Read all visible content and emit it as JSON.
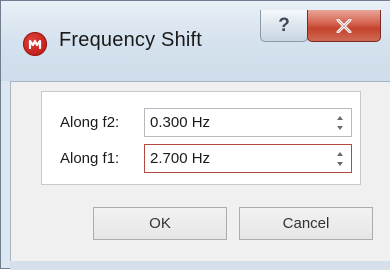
{
  "window": {
    "title": "Frequency Shift",
    "help_label": "?",
    "icon": "app-logo-icon",
    "close_icon": "close-icon"
  },
  "fields": [
    {
      "label": "Along f2:",
      "value": "0.300 Hz"
    },
    {
      "label": "Along f1:",
      "value": "2.700 Hz"
    }
  ],
  "buttons": {
    "ok_label": "OK",
    "cancel_label": "Cancel"
  },
  "colors": {
    "app_icon": "#c3201c",
    "close_button": "#c3432d",
    "active_field_border": "#b24a42"
  }
}
